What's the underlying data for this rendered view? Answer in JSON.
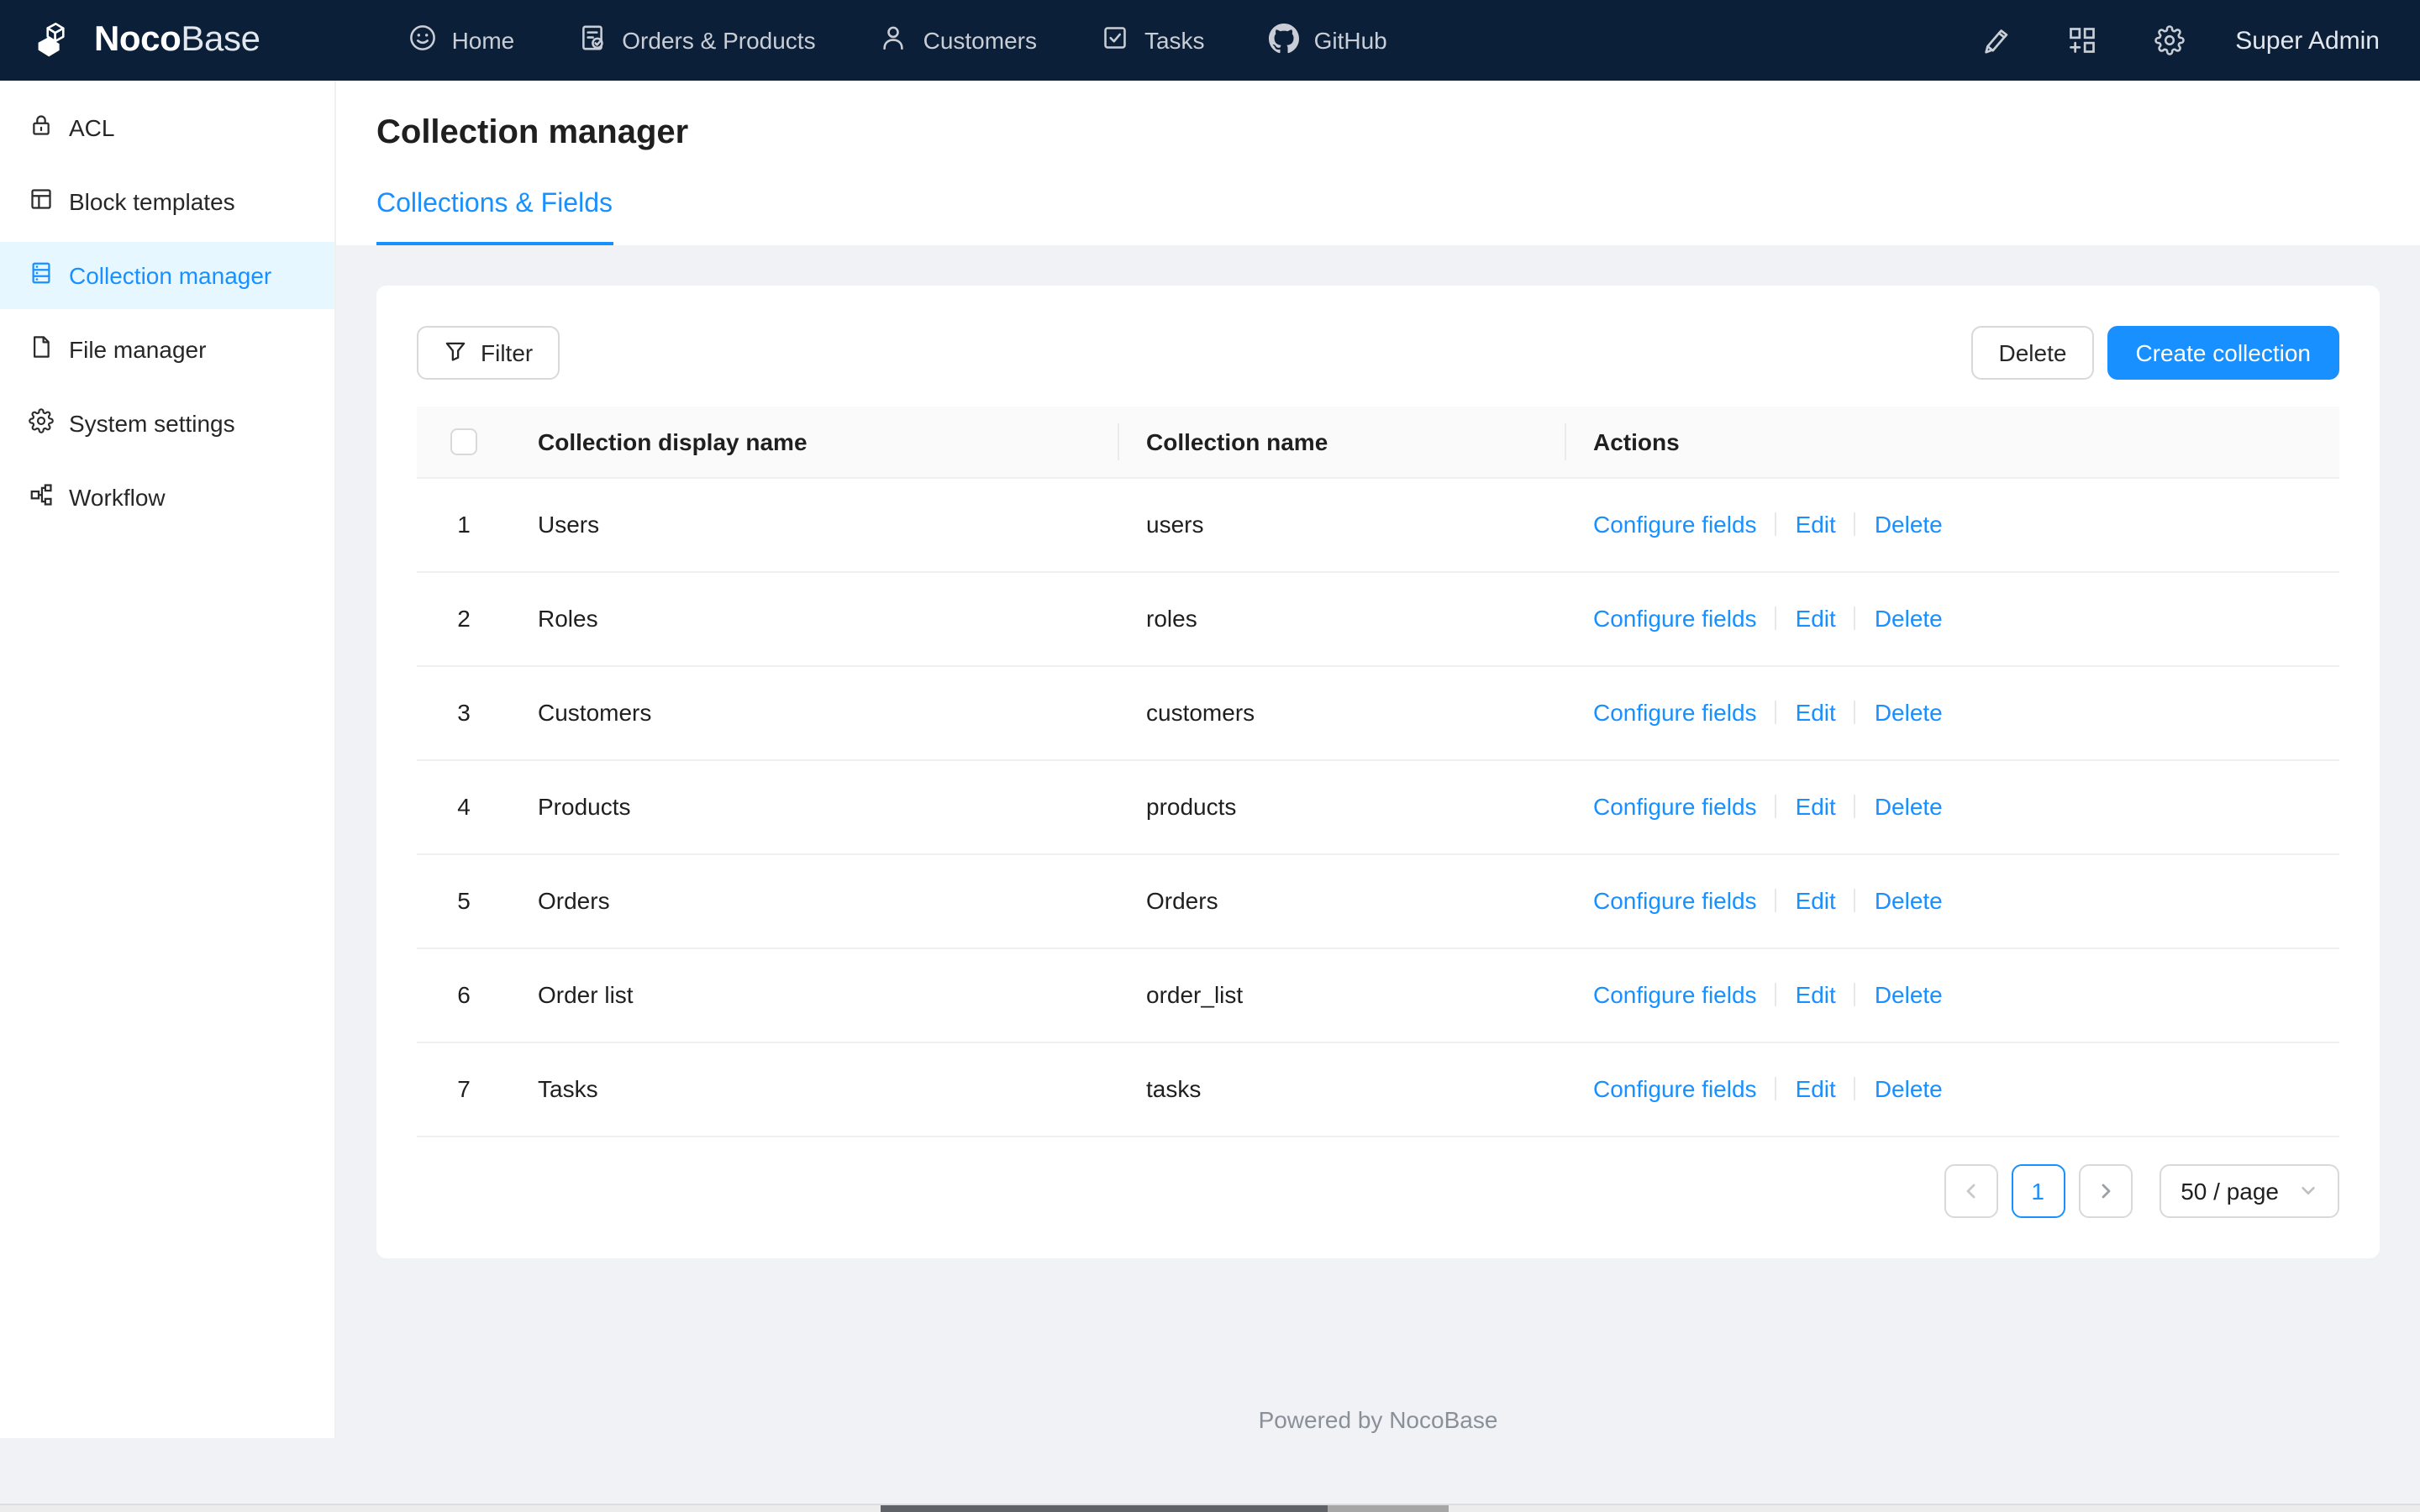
{
  "topbar": {
    "brand_bold": "Noco",
    "brand_light": "Base",
    "nav": [
      {
        "label": "Home",
        "icon": "smile-icon"
      },
      {
        "label": "Orders & Products",
        "icon": "profile-icon"
      },
      {
        "label": "Customers",
        "icon": "user-icon"
      },
      {
        "label": "Tasks",
        "icon": "check-square-icon"
      },
      {
        "label": "GitHub",
        "icon": "github-icon"
      }
    ],
    "user": "Super Admin"
  },
  "sidebar": {
    "items": [
      {
        "label": "ACL",
        "icon": "lock-icon"
      },
      {
        "label": "Block templates",
        "icon": "layout-icon"
      },
      {
        "label": "Collection manager",
        "icon": "database-icon"
      },
      {
        "label": "File manager",
        "icon": "file-icon"
      },
      {
        "label": "System settings",
        "icon": "gear-icon"
      },
      {
        "label": "Workflow",
        "icon": "workflow-icon"
      }
    ]
  },
  "page": {
    "title": "Collection manager",
    "tab": "Collections & Fields"
  },
  "toolbar": {
    "filter_label": "Filter",
    "delete_label": "Delete",
    "create_label": "Create collection"
  },
  "table": {
    "columns": {
      "display_name": "Collection display name",
      "name": "Collection name",
      "actions": "Actions"
    },
    "action_labels": {
      "configure": "Configure fields",
      "edit": "Edit",
      "delete": "Delete"
    },
    "rows": [
      {
        "index": "1",
        "display_name": "Users",
        "name": "users"
      },
      {
        "index": "2",
        "display_name": "Roles",
        "name": "roles"
      },
      {
        "index": "3",
        "display_name": "Customers",
        "name": "customers"
      },
      {
        "index": "4",
        "display_name": "Products",
        "name": "products"
      },
      {
        "index": "5",
        "display_name": "Orders",
        "name": "Orders"
      },
      {
        "index": "6",
        "display_name": "Order list",
        "name": "order_list"
      },
      {
        "index": "7",
        "display_name": "Tasks",
        "name": "tasks"
      }
    ]
  },
  "pagination": {
    "current_page": "1",
    "page_size": "50 / page"
  },
  "footer": {
    "text": "Powered by NocoBase"
  },
  "colors": {
    "accent": "#1890ff",
    "topbar_bg": "#0c1f38",
    "selected_bg": "#e6f7ff",
    "body_bg": "#f0f2f5"
  }
}
